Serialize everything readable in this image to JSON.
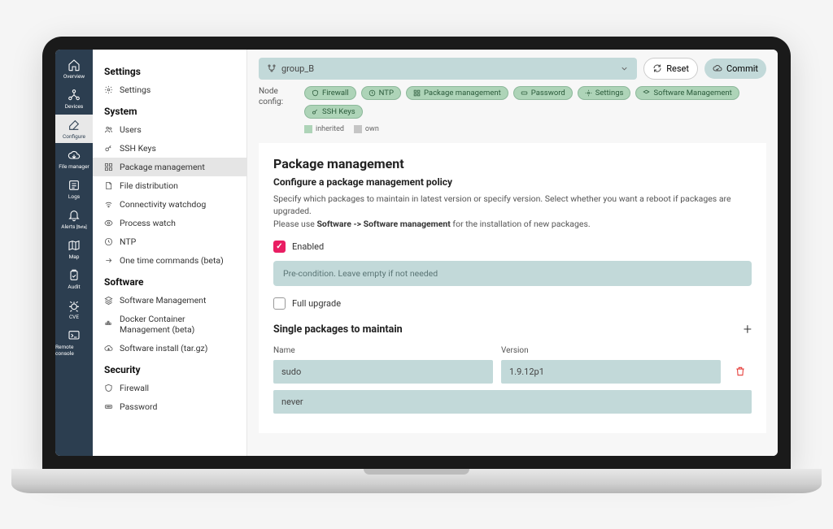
{
  "iconSidebar": [
    {
      "name": "overview",
      "label": "Overview"
    },
    {
      "name": "devices",
      "label": "Devices"
    },
    {
      "name": "configure",
      "label": "Configure",
      "active": true
    },
    {
      "name": "file-manager",
      "label": "File manager"
    },
    {
      "name": "logs",
      "label": "Logs"
    },
    {
      "name": "alerts",
      "label": "Alerts",
      "badge": "[Beta]"
    },
    {
      "name": "map",
      "label": "Map"
    },
    {
      "name": "audit",
      "label": "Audit"
    },
    {
      "name": "cve",
      "label": "CVE"
    },
    {
      "name": "remote-console",
      "label": "Remote console"
    }
  ],
  "innerSidebar": {
    "sections": [
      {
        "title": "Settings",
        "items": [
          {
            "label": "Settings",
            "icon": "gear"
          }
        ]
      },
      {
        "title": "System",
        "items": [
          {
            "label": "Users",
            "icon": "users"
          },
          {
            "label": "SSH Keys",
            "icon": "key"
          },
          {
            "label": "Package management",
            "icon": "grid",
            "active": true
          },
          {
            "label": "File distribution",
            "icon": "file"
          },
          {
            "label": "Connectivity watchdog",
            "icon": "wifi"
          },
          {
            "label": "Process watch",
            "icon": "eye"
          },
          {
            "label": "NTP",
            "icon": "clock"
          },
          {
            "label": "One time commands (beta)",
            "icon": "arrow"
          }
        ]
      },
      {
        "title": "Software",
        "items": [
          {
            "label": "Software Management",
            "icon": "layers"
          },
          {
            "label": "Docker Container Management (beta)",
            "icon": "container"
          },
          {
            "label": "Software install (tar.gz)",
            "icon": "cloud"
          }
        ]
      },
      {
        "title": "Security",
        "items": [
          {
            "label": "Firewall",
            "icon": "shield"
          },
          {
            "label": "Password",
            "icon": "password"
          }
        ]
      }
    ]
  },
  "topbar": {
    "group": "group_B",
    "reset": "Reset",
    "commit": "Commit"
  },
  "nodeConfig": {
    "label": "Node config:",
    "pills": [
      {
        "label": "Firewall",
        "icon": "shield"
      },
      {
        "label": "NTP",
        "icon": "clock"
      },
      {
        "label": "Package management",
        "icon": "grid"
      },
      {
        "label": "Password",
        "icon": "password"
      },
      {
        "label": "Settings",
        "icon": "gear"
      },
      {
        "label": "Software Management",
        "icon": "layers"
      },
      {
        "label": "SSH Keys",
        "icon": "key"
      }
    ],
    "legend": {
      "inherited": "inherited",
      "own": "own"
    }
  },
  "page": {
    "title": "Package management",
    "subtitle": "Configure a package management policy",
    "descLine1": "Specify which packages to maintain in latest version or specify version. Select whether you want a reboot if packages are upgraded.",
    "descLine2a": "Please use ",
    "descLine2b": "Software -> Software management",
    "descLine2c": " for the installation of new packages.",
    "enabledLabel": "Enabled",
    "precondPlaceholder": "Pre-condition. Leave empty if not needed",
    "fullUpgradeLabel": "Full upgrade",
    "packagesTitle": "Single packages to maintain",
    "colName": "Name",
    "colVersion": "Version",
    "packages": [
      {
        "name": "sudo",
        "version": "1.9.12p1"
      },
      {
        "name": "never",
        "version": ""
      }
    ]
  }
}
